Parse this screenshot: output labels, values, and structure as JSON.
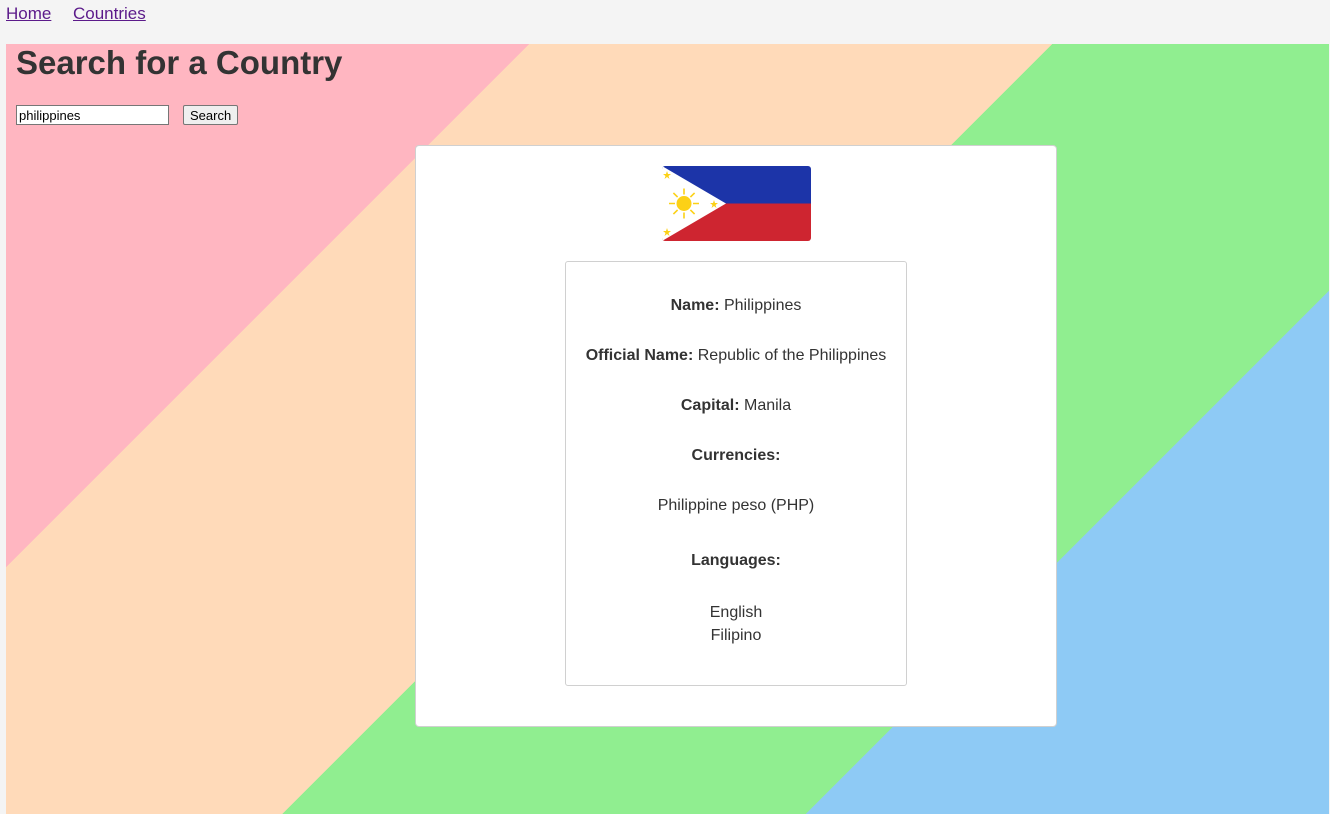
{
  "nav": {
    "home": "Home",
    "countries": "Countries"
  },
  "page": {
    "title": "Search for a Country"
  },
  "search": {
    "value": "philippines",
    "button_label": "Search"
  },
  "country": {
    "name_label": "Name:",
    "name": "Philippines",
    "official_name_label": "Official Name:",
    "official_name": "Republic of the Philippines",
    "capital_label": "Capital:",
    "capital": "Manila",
    "currencies_label": "Currencies:",
    "currencies": [
      "Philippine peso (PHP)"
    ],
    "languages_label": "Languages:",
    "languages": [
      "English",
      "Filipino"
    ]
  },
  "colors": {
    "stripe_pink": "#ffb6c1",
    "stripe_peach": "#ffdab9",
    "stripe_green": "#90ee90",
    "stripe_blue": "#8ecaf5",
    "flag_blue": "#1c34a8",
    "flag_red": "#ce2530",
    "flag_sun": "#fcd116"
  }
}
